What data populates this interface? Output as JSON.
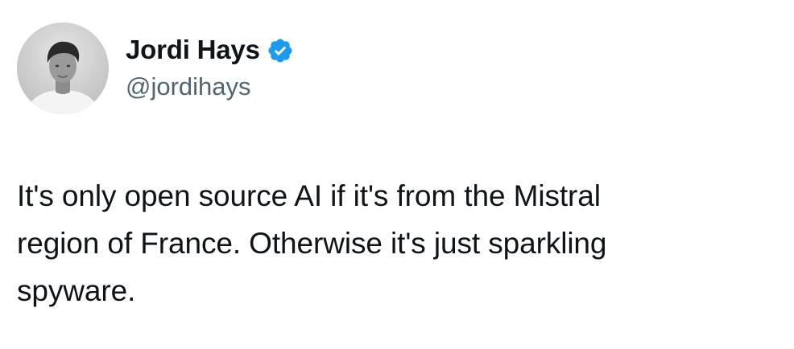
{
  "author": {
    "name": "Jordi Hays",
    "handle": "@jordihays",
    "verified": true,
    "verified_color": "#1d9bf0",
    "avatar_icon": "profile-photo"
  },
  "tweet": {
    "text": "It's only open source AI if it's from the Mistral\nregion of France. Otherwise it's just sparkling\nspyware."
  }
}
